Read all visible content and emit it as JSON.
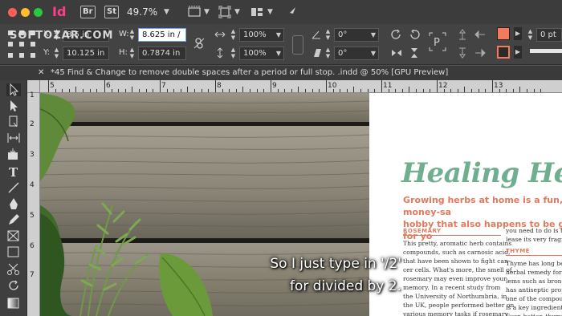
{
  "titlebar": {
    "app_icon": "Id",
    "bridge_badge": "Br",
    "stock_badge": "St",
    "zoom": "49.7%"
  },
  "watermark": "SOFTOZAR.COM",
  "control_panel": {
    "x_label": "X:",
    "x_value": "8.5 in",
    "y_label": "Y:",
    "y_value": "10.125 in",
    "w_label": "W:",
    "w_value": "8.625 in /",
    "h_label": "H:",
    "h_value": "0.7874 in",
    "scale_x": "100%",
    "scale_y": "100%",
    "rotate": "0°",
    "shear": "0°",
    "stroke_weight": "0 pt",
    "fill_color": "#f47a5e"
  },
  "document_tab": {
    "title": "*45 Find & Change to remove double spaces after a period or full stop. .indd @ 50% [GPU Preview]"
  },
  "rulers": {
    "horizontal": [
      "5",
      "6",
      "7",
      "8",
      "9",
      "10",
      "11",
      "12",
      "13"
    ],
    "vertical": [
      "1",
      "2",
      "3",
      "4",
      "5",
      "6",
      "7"
    ]
  },
  "page_content": {
    "heading": "Healing Herbs",
    "intro_line1": "Growing herbs at home is a fun, money-sa",
    "intro_line2": "hobby that also happens to be good for yo",
    "section1": "ROSEMARY",
    "col1": [
      "This pretty, aromatic herb contains",
      "compounds, such as carnosic acid,",
      "that have been shown to fight can-",
      "cer cells. What's more, the smell of",
      "rosemary may even improve your",
      "memory. In a recent study from",
      "the University of Northumbria, in",
      "the UK, people performed better on",
      "various memory tasks if rosemary",
      "scent was pumped into the room."
    ],
    "col2_top": [
      "you need to do is touc",
      "lease its very fragrant"
    ],
    "section2": "THYME",
    "col2": [
      "Thyme has long bee",
      "herbal remedy for res",
      "lems such as bronchi",
      "has antiseptic prope",
      "one of the compound",
      "is a key ingredient",
      "Even better, thyme is"
    ]
  },
  "caption": {
    "line1": "So I just type in '/2'",
    "line2": "for divided by 2."
  }
}
